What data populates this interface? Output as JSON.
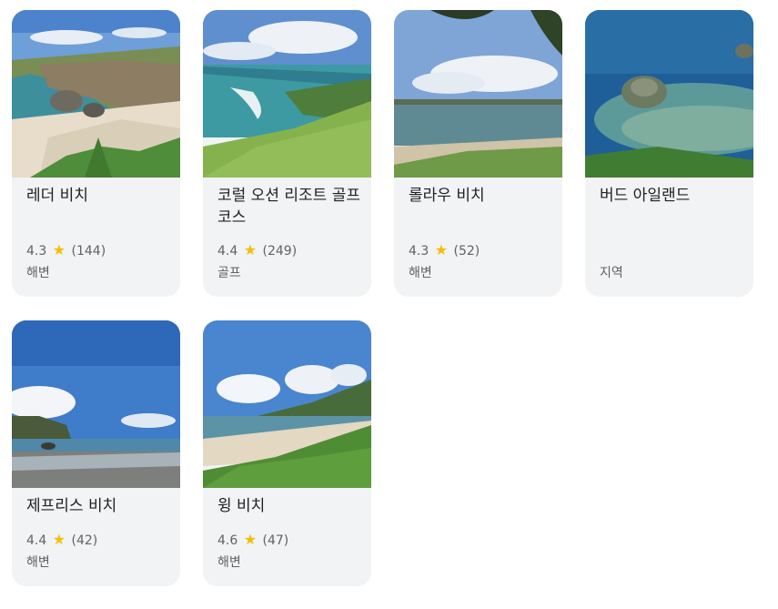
{
  "places": [
    {
      "name": "레더 비치",
      "rating": "4.3",
      "star": "★",
      "reviews": "(144)",
      "category": "해변"
    },
    {
      "name": "코럴 오션 리조트 골프 코스",
      "rating": "4.4",
      "star": "★",
      "reviews": "(249)",
      "category": "골프"
    },
    {
      "name": "롤라우 비치",
      "rating": "4.3",
      "star": "★",
      "reviews": "(52)",
      "category": "해변"
    },
    {
      "name": "버드 아일랜드",
      "category": "지역"
    },
    {
      "name": "제프리스 비치",
      "rating": "4.4",
      "star": "★",
      "reviews": "(42)",
      "category": "해변"
    },
    {
      "name": "윙 비치",
      "rating": "4.6",
      "star": "★",
      "reviews": "(47)",
      "category": "해변"
    }
  ],
  "colors": {
    "card_bg": "#f1f3f4",
    "star": "#fbbc04",
    "title": "#202124",
    "secondary": "#5f6368"
  }
}
